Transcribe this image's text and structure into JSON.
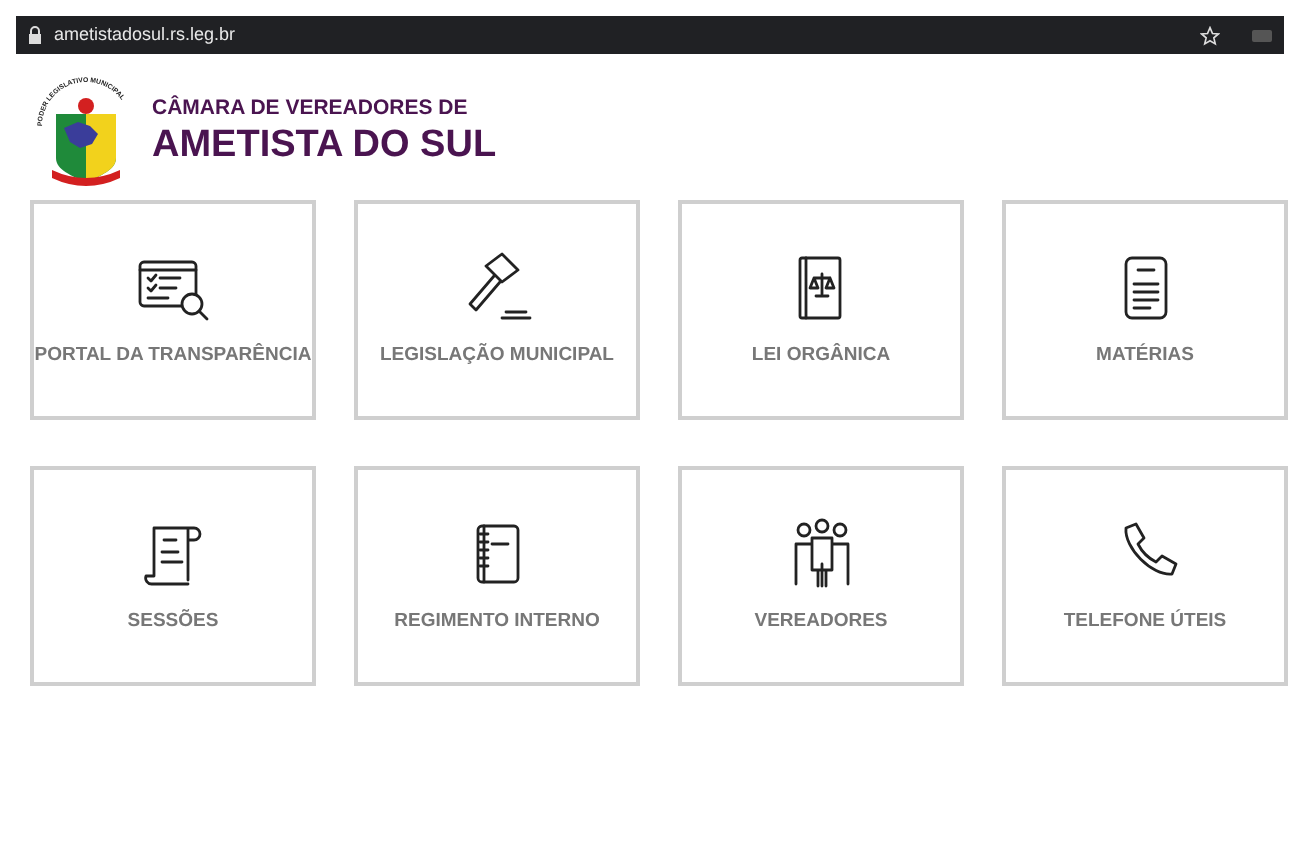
{
  "browser": {
    "url": "ametistadosul.rs.leg.br"
  },
  "header": {
    "emblem_text": "PODER LEGISLATIVO MUNICIPAL",
    "title_line_1": "CÂMARA DE VEREADORES DE",
    "title_line_2": "AMETISTA DO SUL"
  },
  "cards": [
    {
      "label": "PORTAL DA TRANSPARÊNCIA",
      "kind": "checklist"
    },
    {
      "label": "LEGISLAÇÃO MUNICIPAL",
      "kind": "gavel"
    },
    {
      "label": "LEI ORGÂNICA",
      "kind": "lawbook"
    },
    {
      "label": "MATÉRIAS",
      "kind": "document"
    },
    {
      "label": "SESSÕES",
      "kind": "scroll"
    },
    {
      "label": "REGIMENTO INTERNO",
      "kind": "notebook"
    },
    {
      "label": "VEREADORES",
      "kind": "people"
    },
    {
      "label": "TELEFONE ÚTEIS",
      "kind": "phone"
    }
  ]
}
